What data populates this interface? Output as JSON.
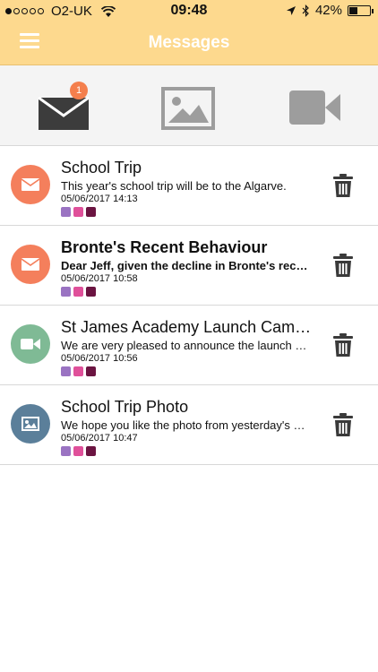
{
  "status_bar": {
    "carrier": "O2-UK",
    "time": "09:48",
    "battery": "42%",
    "battery_level": 0.42
  },
  "header": {
    "title": "Messages"
  },
  "tabs": [
    {
      "name": "mail",
      "icon": "envelope-icon",
      "badge": "1"
    },
    {
      "name": "image",
      "icon": "image-icon"
    },
    {
      "name": "video",
      "icon": "video-camera-icon"
    }
  ],
  "colors": {
    "header_bg": "#fdd98e",
    "mail_avatar": "#f47f5c",
    "video_avatar": "#7fba95",
    "image_avatar": "#5b7f9a",
    "tag_1": "#9a73c2",
    "tag_2": "#e0509a",
    "tag_3": "#6b1441"
  },
  "messages": [
    {
      "type": "mail",
      "title": "School Trip",
      "preview": "This year's school trip will be to the Algarve.",
      "date": "05/06/2017 14:13",
      "unread": false
    },
    {
      "type": "mail",
      "title": "Bronte's Recent Behaviour",
      "preview": "Dear Jeff, given the decline in Bronte's recent behaviour",
      "date": "05/06/2017 10:58",
      "unread": true
    },
    {
      "type": "video",
      "title": "St James Academy Launch Campaign",
      "preview": "We are very pleased to announce the launch of our new",
      "date": "05/06/2017 10:56",
      "unread": false
    },
    {
      "type": "image",
      "title": "School Trip Photo",
      "preview": "We hope you like the photo from yesterday's school trip",
      "date": "05/06/2017 10:47",
      "unread": false
    }
  ]
}
